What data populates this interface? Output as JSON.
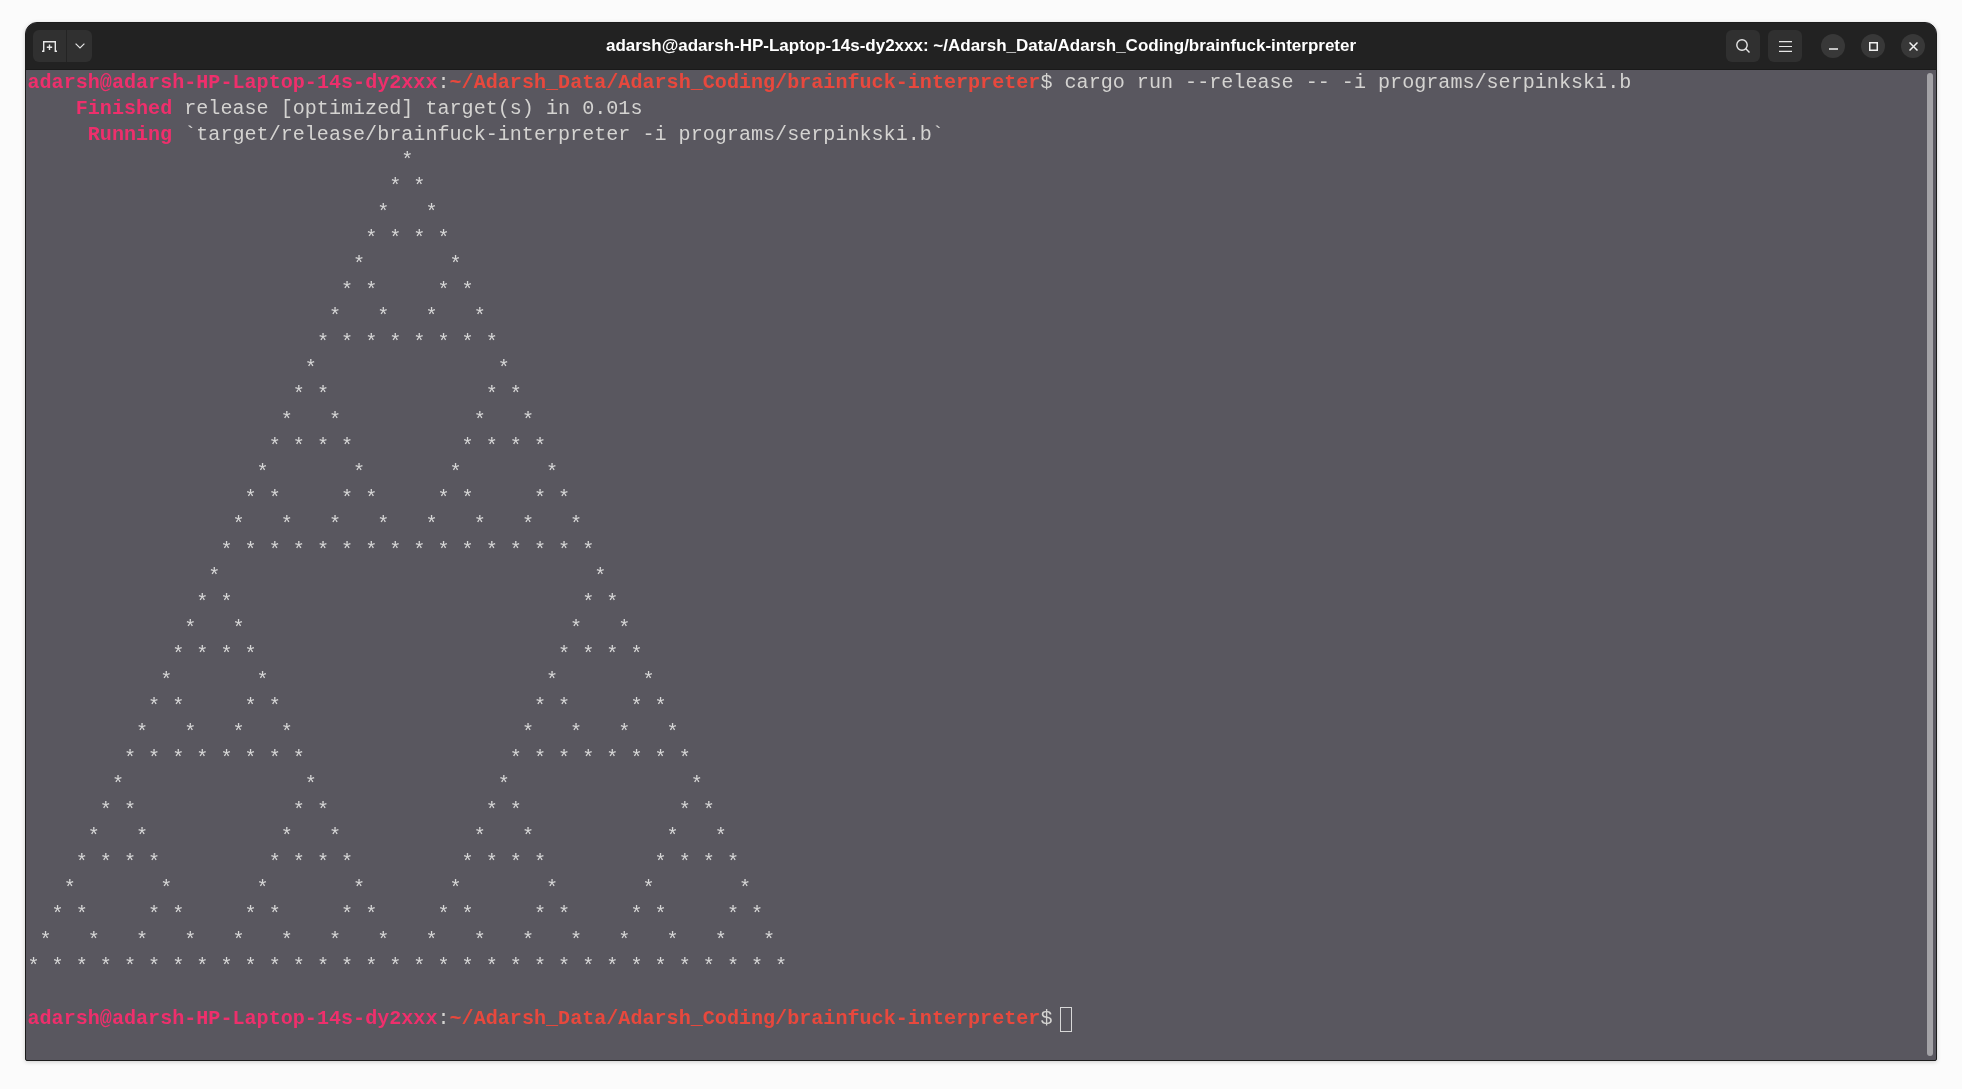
{
  "window": {
    "title": "adarsh@adarsh-HP-Laptop-14s-dy2xxx: ~/Adarsh_Data/Adarsh_Coding/brainfuck-interpreter"
  },
  "terminal": {
    "lines": [
      {
        "kind": "prompt",
        "user_host": "adarsh@adarsh-HP-Laptop-14s-dy2xxx",
        "separator": ":",
        "path": "~/Adarsh_Data/Adarsh_Coding/brainfuck-interpreter",
        "symbol": "$",
        "command": "cargo run --release -- -i programs/serpinkski.b",
        "cursor": false
      },
      {
        "kind": "status",
        "status": "Finished",
        "text": "release [optimized] target(s) in 0.01s"
      },
      {
        "kind": "status",
        "status": "Running",
        "text": "`target/release/brainfuck-interpreter -i programs/serpinkski.b`"
      },
      {
        "kind": "output",
        "text": "                               *\n                              * *\n                             *   *\n                            * * * *\n                           *       *\n                          * *     * *\n                         *   *   *   *\n                        * * * * * * * *\n                       *               *\n                      * *             * *\n                     *   *           *   *\n                    * * * *         * * * *\n                   *       *       *       *\n                  * *     * *     * *     * *\n                 *   *   *   *   *   *   *   *\n                * * * * * * * * * * * * * * * *\n               *                               *\n              * *                             * *\n             *   *                           *   *\n            * * * *                         * * * *\n           *       *                       *       *\n          * *     * *                     * *     * *\n         *   *   *   *                   *   *   *   *\n        * * * * * * * *                 * * * * * * * *\n       *               *               *               *\n      * *             * *             * *             * *\n     *   *           *   *           *   *           *   *\n    * * * *         * * * *         * * * *         * * * *\n   *       *       *       *       *       *       *       *\n  * *     * *     * *     * *     * *     * *     * *     * *\n *   *   *   *   *   *   *   *   *   *   *   *   *   *   *   *\n* * * * * * * * * * * * * * * * * * * * * * * * * * * * * * * *"
      },
      {
        "kind": "blank"
      },
      {
        "kind": "prompt",
        "user_host": "adarsh@adarsh-HP-Laptop-14s-dy2xxx",
        "separator": ":",
        "path": "~/Adarsh_Data/Adarsh_Coding/brainfuck-interpreter",
        "symbol": "$",
        "cursor": true
      }
    ]
  }
}
